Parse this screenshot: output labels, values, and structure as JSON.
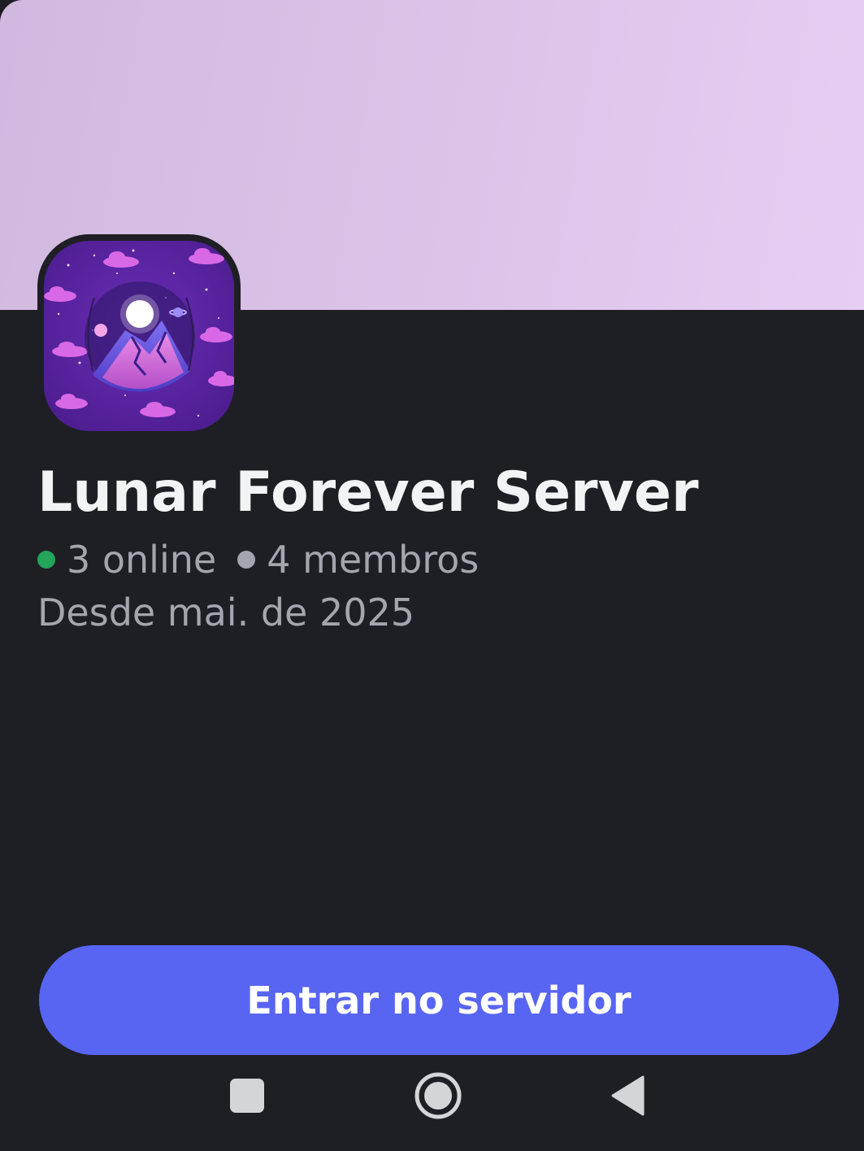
{
  "server": {
    "name": "Lunar Forever Server",
    "online": "3 online",
    "members": "4 membros",
    "since": "Desde mai. de 2025"
  },
  "actions": {
    "join_label": "Entrar no servidor"
  },
  "icons": {
    "server": "mountain-moon-server-icon",
    "online_dot": "online-status-dot",
    "members_dot": "members-dot",
    "nav_recents": "square-recents-icon",
    "nav_home": "circle-home-icon",
    "nav_back": "triangle-back-icon"
  },
  "colors": {
    "background": "#1e1f24",
    "banner_start": "#d1b8df",
    "banner_end": "#e7cdf3",
    "online": "#23a55a",
    "members": "#a3a6ae",
    "accent": "#5865f2",
    "title": "#f2f3f5",
    "muted": "#a3a6ae"
  }
}
